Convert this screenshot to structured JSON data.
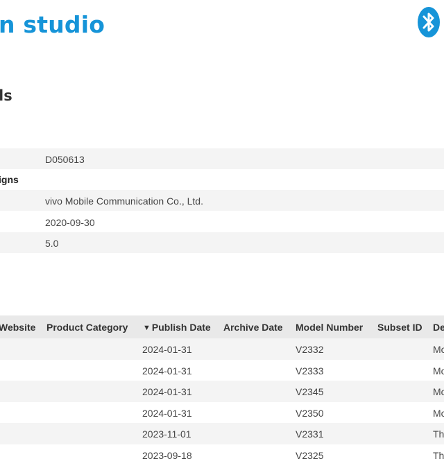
{
  "header": {
    "brand_text": "n studio",
    "brand_color": "#1694d8",
    "logo_icon": "bluetooth-icon"
  },
  "details": {
    "title": "ls",
    "rows": [
      {
        "label": "",
        "value": "",
        "shaded": false
      },
      {
        "label": "",
        "value": "D050613",
        "shaded": true
      },
      {
        "label": "igns",
        "value": "",
        "shaded": false
      },
      {
        "label": "",
        "value": "vivo Mobile Communication Co., Ltd.",
        "shaded": true
      },
      {
        "label": "",
        "value": "2020-09-30",
        "shaded": false
      },
      {
        "label": "",
        "value": "5.0",
        "shaded": true
      },
      {
        "label": "",
        "value": "",
        "shaded": false
      }
    ]
  },
  "listings": {
    "columns": [
      "Website",
      "Product Category",
      "Publish Date",
      "Archive Date",
      "Model Number",
      "Subset ID",
      "De"
    ],
    "sort_indicator": "▼",
    "rows": [
      {
        "publish_date": "2024-01-31",
        "archive_date": "",
        "model": "V2332",
        "subset": "",
        "desc": "Mo"
      },
      {
        "publish_date": "2024-01-31",
        "archive_date": "",
        "model": "V2333",
        "subset": "",
        "desc": "Mo"
      },
      {
        "publish_date": "2024-01-31",
        "archive_date": "",
        "model": "V2345",
        "subset": "",
        "desc": "Mo"
      },
      {
        "publish_date": "2024-01-31",
        "archive_date": "",
        "model": "V2350",
        "subset": "",
        "desc": "Mo"
      },
      {
        "publish_date": "2023-11-01",
        "archive_date": "",
        "model": "V2331",
        "subset": "",
        "desc": "Th"
      },
      {
        "publish_date": "2023-09-18",
        "archive_date": "",
        "model": "V2325",
        "subset": "",
        "desc": "Th"
      }
    ]
  }
}
